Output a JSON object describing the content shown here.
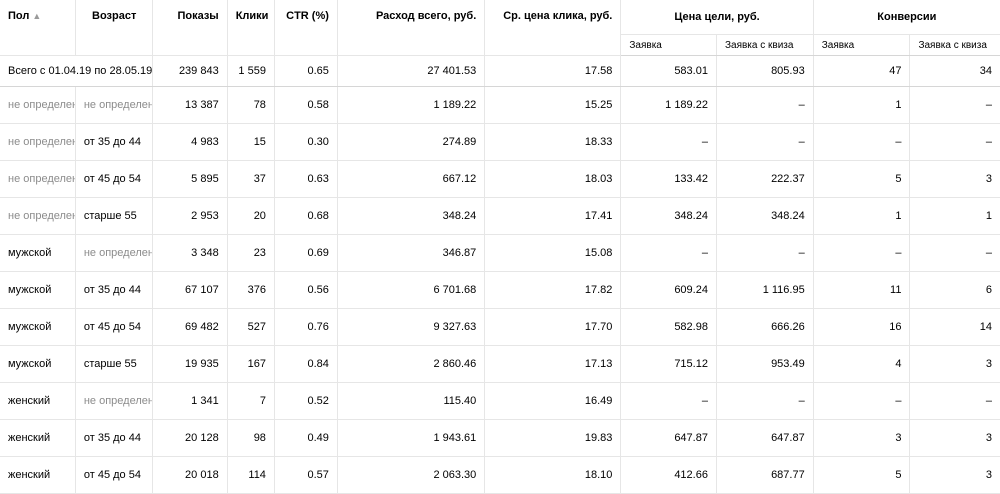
{
  "summary": {
    "label": "Всего с 01.04.19 по 28.05.19",
    "impressions": "239 843",
    "clicks": "1 559",
    "ctr": "0.65",
    "spend": "27 401.53",
    "avg_cpc": "17.58",
    "goal_cost_request": "583.01",
    "goal_cost_quiz": "805.93",
    "conv_request": "47",
    "conv_quiz": "34"
  },
  "headers": {
    "gender": "Пол",
    "sort_arrow": "▲",
    "age": "Возраст",
    "impressions": "Показы",
    "clicks": "Клики",
    "ctr": "CTR (%)",
    "spend": "Расход всего, руб.",
    "avg_cpc": "Ср. цена клика, руб.",
    "goal_cost": "Цена цели, руб.",
    "conversions": "Конверсии",
    "sub_request": "Заявка",
    "sub_quiz": "Заявка с квиза"
  },
  "rows": [
    {
      "gender": "не определен",
      "gender_muted": true,
      "age": "не определен",
      "age_muted": true,
      "impressions": "13 387",
      "clicks": "78",
      "ctr": "0.58",
      "spend": "1 189.22",
      "avg_cpc": "15.25",
      "goal_cost_request": "1 189.22",
      "goal_cost_quiz": "–",
      "conv_request": "1",
      "conv_quiz": "–"
    },
    {
      "gender": "не определен",
      "gender_muted": true,
      "age": "от 35 до 44",
      "age_muted": false,
      "impressions": "4 983",
      "clicks": "15",
      "ctr": "0.30",
      "spend": "274.89",
      "avg_cpc": "18.33",
      "goal_cost_request": "–",
      "goal_cost_quiz": "–",
      "conv_request": "–",
      "conv_quiz": "–"
    },
    {
      "gender": "не определен",
      "gender_muted": true,
      "age": "от 45 до 54",
      "age_muted": false,
      "impressions": "5 895",
      "clicks": "37",
      "ctr": "0.63",
      "spend": "667.12",
      "avg_cpc": "18.03",
      "goal_cost_request": "133.42",
      "goal_cost_quiz": "222.37",
      "conv_request": "5",
      "conv_quiz": "3"
    },
    {
      "gender": "не определен",
      "gender_muted": true,
      "age": "старше 55",
      "age_muted": false,
      "impressions": "2 953",
      "clicks": "20",
      "ctr": "0.68",
      "spend": "348.24",
      "avg_cpc": "17.41",
      "goal_cost_request": "348.24",
      "goal_cost_quiz": "348.24",
      "conv_request": "1",
      "conv_quiz": "1"
    },
    {
      "gender": "мужской",
      "gender_muted": false,
      "age": "не определен",
      "age_muted": true,
      "impressions": "3 348",
      "clicks": "23",
      "ctr": "0.69",
      "spend": "346.87",
      "avg_cpc": "15.08",
      "goal_cost_request": "–",
      "goal_cost_quiz": "–",
      "conv_request": "–",
      "conv_quiz": "–"
    },
    {
      "gender": "мужской",
      "gender_muted": false,
      "age": "от 35 до 44",
      "age_muted": false,
      "impressions": "67 107",
      "clicks": "376",
      "ctr": "0.56",
      "spend": "6 701.68",
      "avg_cpc": "17.82",
      "goal_cost_request": "609.24",
      "goal_cost_quiz": "1 116.95",
      "conv_request": "11",
      "conv_quiz": "6"
    },
    {
      "gender": "мужской",
      "gender_muted": false,
      "age": "от 45 до 54",
      "age_muted": false,
      "impressions": "69 482",
      "clicks": "527",
      "ctr": "0.76",
      "spend": "9 327.63",
      "avg_cpc": "17.70",
      "goal_cost_request": "582.98",
      "goal_cost_quiz": "666.26",
      "conv_request": "16",
      "conv_quiz": "14"
    },
    {
      "gender": "мужской",
      "gender_muted": false,
      "age": "старше 55",
      "age_muted": false,
      "impressions": "19 935",
      "clicks": "167",
      "ctr": "0.84",
      "spend": "2 860.46",
      "avg_cpc": "17.13",
      "goal_cost_request": "715.12",
      "goal_cost_quiz": "953.49",
      "conv_request": "4",
      "conv_quiz": "3"
    },
    {
      "gender": "женский",
      "gender_muted": false,
      "age": "не определен",
      "age_muted": true,
      "impressions": "1 341",
      "clicks": "7",
      "ctr": "0.52",
      "spend": "115.40",
      "avg_cpc": "16.49",
      "goal_cost_request": "–",
      "goal_cost_quiz": "–",
      "conv_request": "–",
      "conv_quiz": "–"
    },
    {
      "gender": "женский",
      "gender_muted": false,
      "age": "от 35 до 44",
      "age_muted": false,
      "impressions": "20 128",
      "clicks": "98",
      "ctr": "0.49",
      "spend": "1 943.61",
      "avg_cpc": "19.83",
      "goal_cost_request": "647.87",
      "goal_cost_quiz": "647.87",
      "conv_request": "3",
      "conv_quiz": "3"
    },
    {
      "gender": "женский",
      "gender_muted": false,
      "age": "от 45 до 54",
      "age_muted": false,
      "impressions": "20 018",
      "clicks": "114",
      "ctr": "0.57",
      "spend": "2 063.30",
      "avg_cpc": "18.10",
      "goal_cost_request": "412.66",
      "goal_cost_quiz": "687.77",
      "conv_request": "5",
      "conv_quiz": "3"
    }
  ]
}
